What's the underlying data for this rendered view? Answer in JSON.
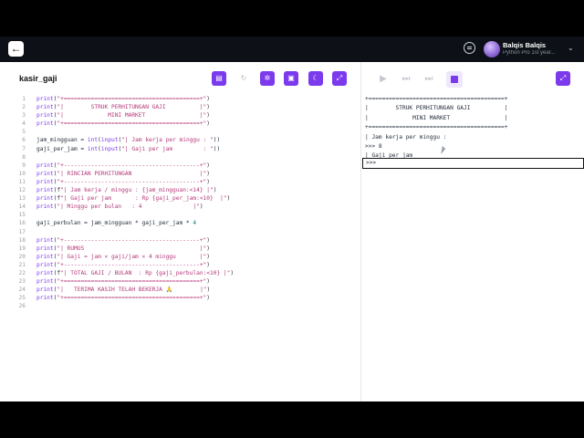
{
  "header": {
    "user_name": "Balqis Balqis",
    "user_plan": "Python Pro 1st year..."
  },
  "editor": {
    "file_name": "kasir_gaji",
    "lines": [
      {
        "n": "1",
        "t": "print(\"+========================================+\")"
      },
      {
        "n": "2",
        "t": "print(\"|        STRUK PERHITUNGAN GAJI          |\")"
      },
      {
        "n": "3",
        "t": "print(\"|             MINI MARKET                |\")"
      },
      {
        "n": "4",
        "t": "print(\"+========================================+\")"
      },
      {
        "n": "5",
        "t": ""
      },
      {
        "n": "6",
        "t": "jam_mingguan = int(input(\"| Jam kerja per minggu : \"))"
      },
      {
        "n": "7",
        "t": "gaji_per_jam = int(input(\"| Gaji per jam         : \"))"
      },
      {
        "n": "8",
        "t": ""
      },
      {
        "n": "9",
        "t": "print(\"+----------------------------------------+\")"
      },
      {
        "n": "10",
        "t": "print(\"| RINCIAN PERHITUNGAN                    |\")"
      },
      {
        "n": "11",
        "t": "print(\"+----------------------------------------+\")"
      },
      {
        "n": "12",
        "t": "print(f\"| Jam kerja / minggu : {jam_mingguan:<14} |\")"
      },
      {
        "n": "13",
        "t": "print(f\"| Gaji per jam       : Rp {gaji_per_jam:<10}  |\")"
      },
      {
        "n": "14",
        "t": "print(\"| Minggu per bulan   : 4               |\")"
      },
      {
        "n": "15",
        "t": ""
      },
      {
        "n": "16",
        "t": "gaji_perbulan = jam_mingguan * gaji_per_jam * 4"
      },
      {
        "n": "17",
        "t": ""
      },
      {
        "n": "18",
        "t": "print(\"+----------------------------------------+\")"
      },
      {
        "n": "19",
        "t": "print(\"| RUMUS                                  |\")"
      },
      {
        "n": "20",
        "t": "print(\"| Gaji = jam × gaji/jam × 4 minggu       |\")"
      },
      {
        "n": "21",
        "t": "print(\"+----------------------------------------+\")"
      },
      {
        "n": "22",
        "t": "print(f\"| TOTAL GAJI / BULAN  : Rp {gaji_perbulan:<10} |\")"
      },
      {
        "n": "23",
        "t": "print(\"+========================================+\")"
      },
      {
        "n": "24",
        "t": "print(\"|   TERIMA KASIH TELAH BEKERJA 🙏        |\")"
      },
      {
        "n": "25",
        "t": "print(\"+========================================+\")"
      },
      {
        "n": "26",
        "t": ""
      }
    ]
  },
  "console": {
    "lines": [
      "+========================================+",
      "|        STRUK PERHITUNGAN GAJI          |",
      "|             MINI MARKET                |",
      "+========================================+",
      "| Jam kerja per minggu : ",
      ">>> 8",
      "| Gaji per jam"
    ],
    "prompt": ">>>"
  },
  "icons": {
    "back": "arrow-left-icon",
    "chat": "chat-bubble-icon",
    "chevron": "chevron-down-icon",
    "run": "play-icon",
    "step": "step-forward-icon",
    "skip": "skip-end-icon",
    "stop": "stop-icon"
  },
  "colors": {
    "accent": "#7c3aed",
    "topbar": "#0d1117"
  }
}
